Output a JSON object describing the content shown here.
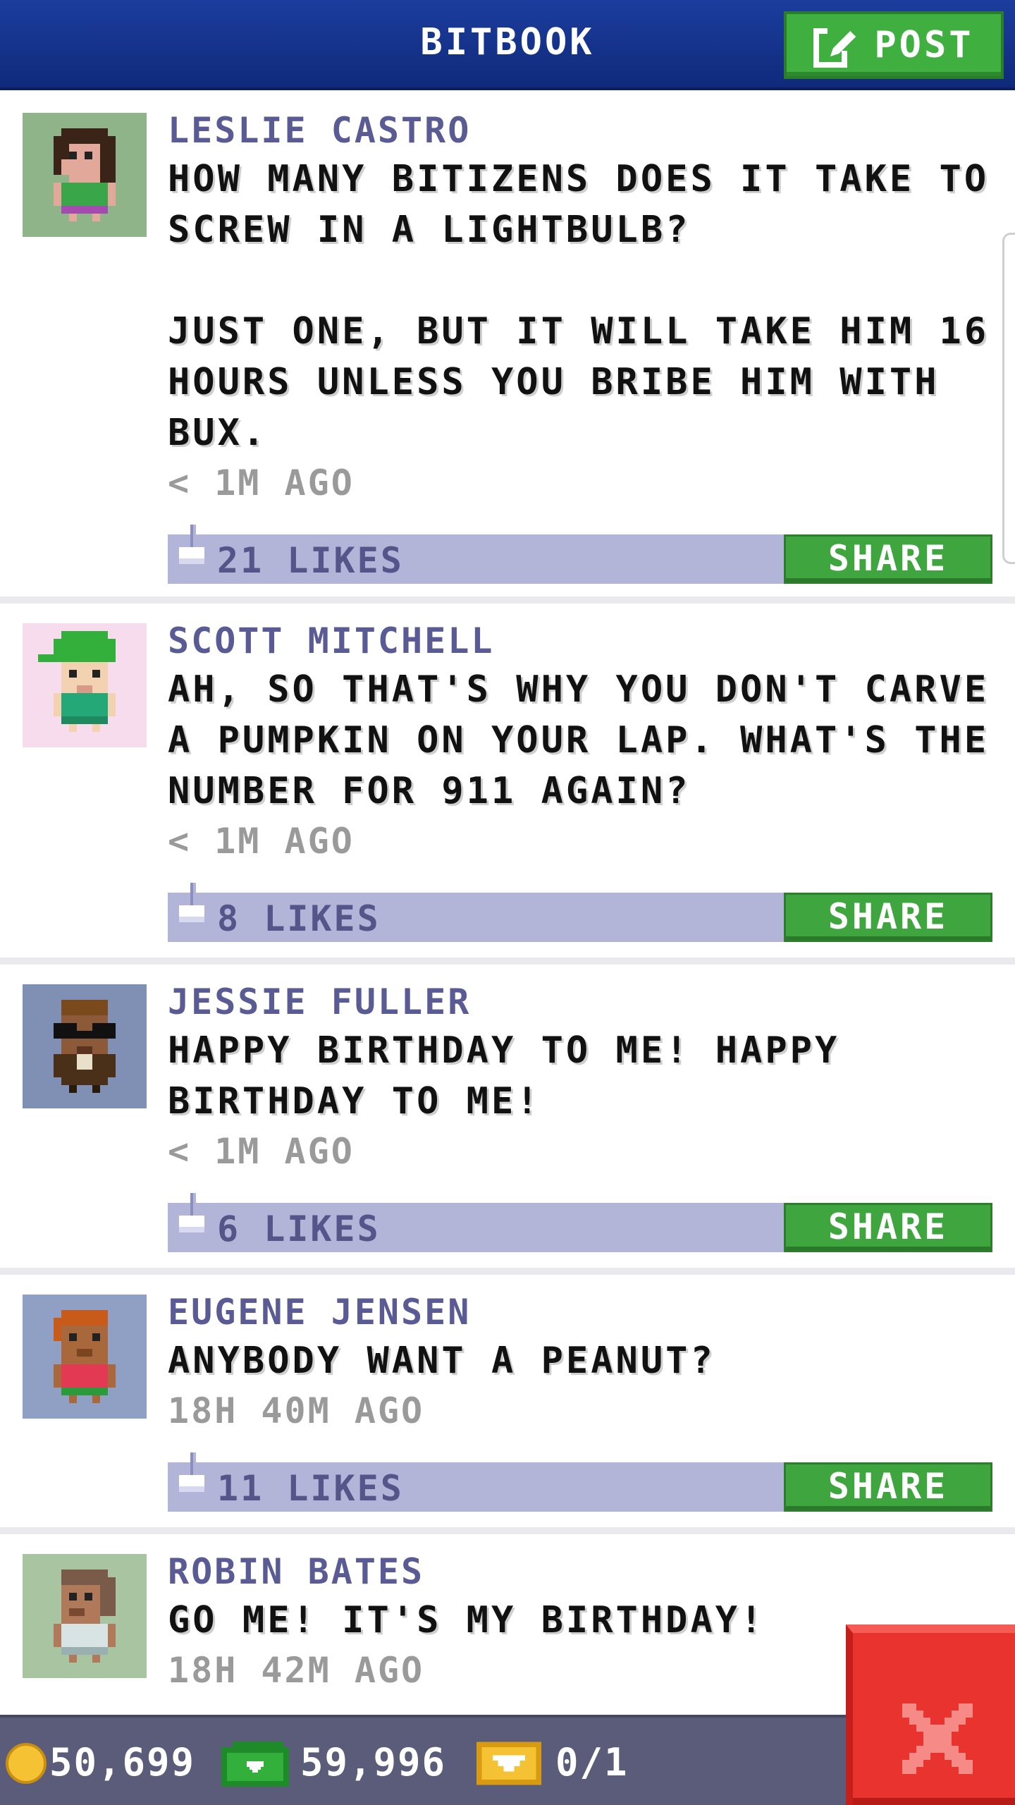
{
  "header": {
    "title": "BITBOOK",
    "post_label": "POST"
  },
  "colors": {
    "header_blue": "#1c3d9e",
    "button_green": "#3fa53f",
    "likes_bar": "#b3b5d8",
    "author_text": "#5a5a94",
    "close_red": "#e8332f"
  },
  "posts": [
    {
      "author": "LESLIE CASTRO",
      "avatar": "avatar-dark-hair-green-shirt",
      "message": "HOW MANY BITIZENS DOES IT TAKE TO\nSCREW IN A LIGHTBULB?\n\nJUST ONE, BUT IT WILL TAKE HIM 16\nHOURS UNLESS YOU BRIBE HIM WITH\nBUX.",
      "time": "< 1M AGO",
      "likes": "21 LIKES",
      "share_label": "SHARE"
    },
    {
      "author": "SCOTT MITCHELL",
      "avatar": "avatar-green-cap",
      "message": "AH, SO THAT'S WHY YOU DON'T CARVE\nA PUMPKIN ON YOUR LAP. WHAT'S THE\nNUMBER FOR 911 AGAIN?",
      "time": "< 1M AGO",
      "likes": "8 LIKES",
      "share_label": "SHARE"
    },
    {
      "author": "JESSIE FULLER",
      "avatar": "avatar-sunglasses-suit",
      "message": "HAPPY BIRTHDAY TO ME! HAPPY\nBIRTHDAY TO ME!",
      "time": "< 1M AGO",
      "likes": "6 LIKES",
      "share_label": "SHARE"
    },
    {
      "author": "EUGENE JENSEN",
      "avatar": "avatar-red-hair-pink-shirt",
      "message": "ANYBODY WANT A PEANUT?",
      "time": "18H 40M AGO",
      "likes": "11 LIKES",
      "share_label": "SHARE"
    },
    {
      "author": "ROBIN BATES",
      "avatar": "avatar-brown-hair-light-shirt",
      "message": "GO ME! IT'S MY BIRTHDAY!",
      "time": "18H 42M AGO"
    }
  ],
  "status": {
    "coins": "50,699",
    "bux": "59,996",
    "tickets": "0/1"
  },
  "icons": {
    "post": "edit-icon",
    "like": "thumbs-up-icon",
    "coin": "coin-icon",
    "bux": "bux-icon",
    "ticket": "ticket-icon",
    "close": "close-icon"
  }
}
